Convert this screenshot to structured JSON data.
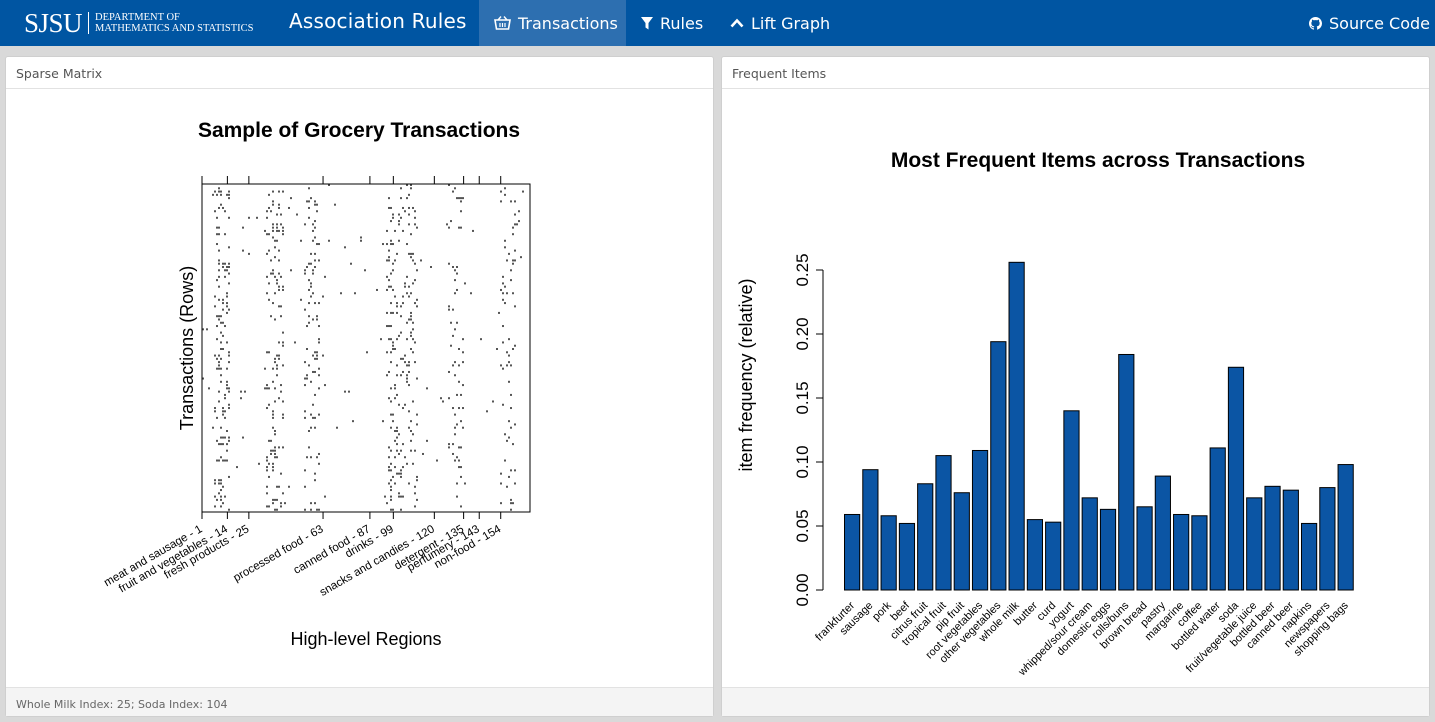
{
  "navbar": {
    "logo_main": "SJSU",
    "logo_dept_line1": "DEPARTMENT OF",
    "logo_dept_line2": "MATHEMATICS AND STATISTICS",
    "brand": "Association Rules",
    "tabs": [
      {
        "label": "Transactions",
        "icon": "basket-icon",
        "active": true
      },
      {
        "label": "Rules",
        "icon": "filter-icon",
        "active": false
      },
      {
        "label": "Lift Graph",
        "icon": "chevron-up-icon",
        "active": false
      }
    ],
    "source_link": {
      "label": "Source Code",
      "icon": "github-icon"
    }
  },
  "colors": {
    "navbar": "#0055a2",
    "active_tab": "#2d6fb0",
    "bar_fill": "#0b55a4"
  },
  "left_panel": {
    "header": "Sparse Matrix",
    "footer": "Whole Milk Index: 25; Soda Index: 104"
  },
  "right_panel": {
    "header": "Frequent Items"
  },
  "chart_data": [
    {
      "type": "heatmap",
      "title": "Sample of Grocery Transactions",
      "xlabel": "High-level Regions",
      "ylabel": "Transactions (Rows)",
      "x_range": [
        1,
        169
      ],
      "x_ticks": [
        {
          "label": "meat and sausage - 1",
          "value": 1
        },
        {
          "label": "fruit and vegetables - 14",
          "value": 14
        },
        {
          "label": "fresh products - 25",
          "value": 25
        },
        {
          "label": "processed food - 63",
          "value": 63
        },
        {
          "label": "canned food - 87",
          "value": 87
        },
        {
          "label": "drinks - 99",
          "value": 99
        },
        {
          "label": "snacks and candies - 120",
          "value": 120
        },
        {
          "label": "detergent - 135",
          "value": 135
        },
        {
          "label": "perfumery - 143",
          "value": 143
        },
        {
          "label": "non-food - 154",
          "value": 154
        }
      ]
    },
    {
      "type": "bar",
      "title": "Most Frequent Items across Transactions",
      "xlabel": "",
      "ylabel": "item frequency (relative)",
      "ylim": [
        0,
        0.25
      ],
      "y_ticks": [
        "0.00",
        "0.05",
        "0.10",
        "0.15",
        "0.20",
        "0.25"
      ],
      "categories": [
        "frankfurter",
        "sausage",
        "pork",
        "beef",
        "citrus fruit",
        "tropical fruit",
        "pip fruit",
        "root vegetables",
        "other vegetables",
        "whole milk",
        "butter",
        "curd",
        "yogurt",
        "whipped/sour cream",
        "domestic eggs",
        "rolls/buns",
        "brown bread",
        "pastry",
        "margarine",
        "coffee",
        "bottled water",
        "soda",
        "fruit/vegetable juice",
        "bottled beer",
        "canned beer",
        "napkins",
        "newspapers",
        "shopping bags"
      ],
      "values": [
        0.059,
        0.094,
        0.058,
        0.052,
        0.083,
        0.105,
        0.076,
        0.109,
        0.194,
        0.256,
        0.055,
        0.053,
        0.14,
        0.072,
        0.063,
        0.184,
        0.065,
        0.089,
        0.059,
        0.058,
        0.111,
        0.174,
        0.072,
        0.081,
        0.078,
        0.052,
        0.08,
        0.098
      ]
    }
  ]
}
